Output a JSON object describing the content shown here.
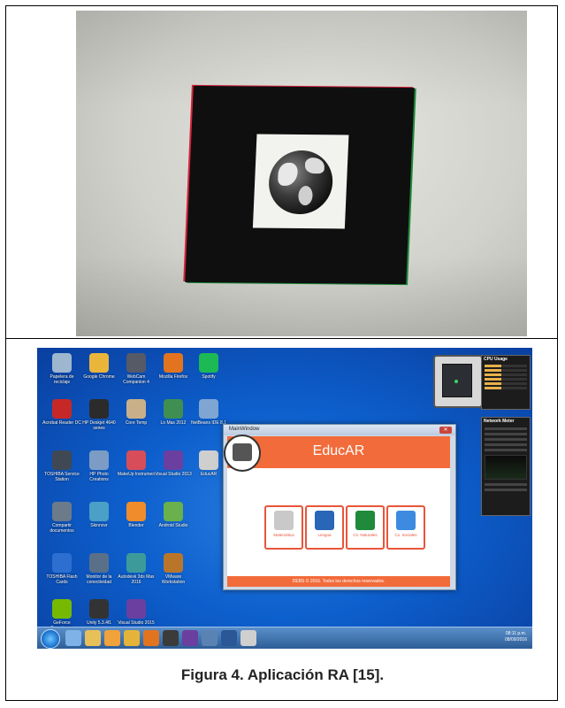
{
  "desktop": {
    "icons": [
      {
        "label": "Papelera de reciclaje",
        "color": "#9fb6cf"
      },
      {
        "label": "Google Chrome",
        "color": "#e9b53a"
      },
      {
        "label": "WebCam Companion 4",
        "color": "#555a66"
      },
      {
        "label": "Mozilla Firefox",
        "color": "#e2741f"
      },
      {
        "label": "Spotify",
        "color": "#1db954"
      },
      {
        "label": "Acrobat Reader DC",
        "color": "#c62828"
      },
      {
        "label": "HP Deskjet 4640 series",
        "color": "#2b2b2b"
      },
      {
        "label": "Core Temp",
        "color": "#c9b08a"
      },
      {
        "label": "Lo Mas 2012",
        "color": "#3f8f53"
      },
      {
        "label": "NetBeans IDE 8.1",
        "color": "#7fa6d2"
      },
      {
        "label": "TOSHIBA Service Station",
        "color": "#404854"
      },
      {
        "label": "HP Photo Creations",
        "color": "#7c9cc6"
      },
      {
        "label": "MakeUp Instrumen",
        "color": "#d74d5a"
      },
      {
        "label": "Visual Studio 2013",
        "color": "#6b3fa0"
      },
      {
        "label": "EducAR",
        "color": "#cfcfcf"
      },
      {
        "label": "Compartir documentos",
        "color": "#6c7a89"
      },
      {
        "label": "Skinnovr",
        "color": "#4aa0c6"
      },
      {
        "label": "Blender",
        "color": "#f08c2b"
      },
      {
        "label": "Android Studio",
        "color": "#6ab04c"
      },
      {
        "label": "TOSHIBA Flash Cards",
        "color": "#2c6fd1"
      },
      {
        "label": "Monitor de la conectividad",
        "color": "#5a6f88"
      },
      {
        "label": "Autodesk 3ds Max 2016",
        "color": "#3c9b9a"
      },
      {
        "label": "VMware Workstation",
        "color": "#b9762b"
      },
      {
        "label": "GeForce Experience",
        "color": "#76b900"
      },
      {
        "label": "Unity 5.3.4f1",
        "color": "#333333"
      },
      {
        "label": "Visual Studio 2015",
        "color": "#6b3fa0"
      }
    ],
    "gadgets": {
      "cpu_title": "CPU Usage",
      "net_title": "Network Meter"
    },
    "taskbar": {
      "time": "08:11 p.m.",
      "date": "08/09/2016"
    }
  },
  "mainwindow": {
    "title": "MainWindow",
    "app_title": "EducAR",
    "tiles": [
      {
        "label": "Matemática",
        "color": "#c9c9c9"
      },
      {
        "label": "Lengua",
        "color": "#2a66b8"
      },
      {
        "label": "Cs. Naturales",
        "color": "#1f8a3b"
      },
      {
        "label": "Cs. Sociales",
        "color": "#3d8be0"
      }
    ],
    "footer": "DEBS © 2016. Todos los derechos reservados."
  },
  "caption": "Figura 4. Aplicación RA [15]."
}
